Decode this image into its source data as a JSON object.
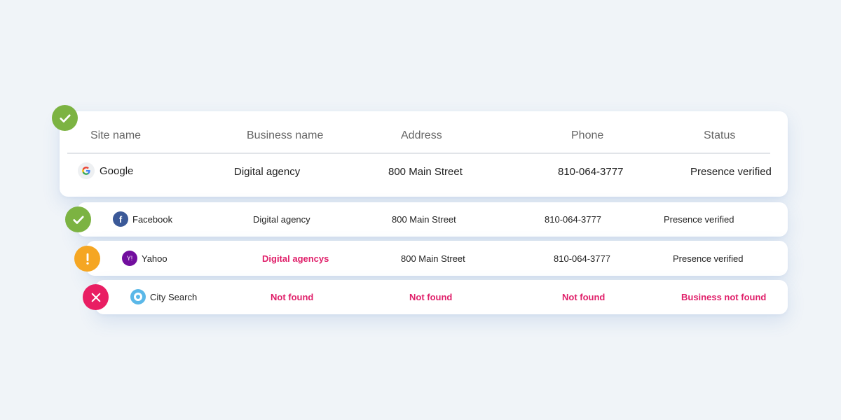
{
  "header": {
    "site_name": "Site name",
    "business_name": "Business name",
    "address": "Address",
    "phone": "Phone",
    "status": "Status"
  },
  "rows": [
    {
      "status_icon": "check-icon",
      "status_color": "#7cb342",
      "site_logo": "google-logo-icon",
      "site": "Google",
      "business": "Digital agency",
      "address": "800 Main Street",
      "phone": "810-064-3777",
      "status": "Presence verified"
    },
    {
      "status_icon": "check-icon",
      "status_color": "#7cb342",
      "site_logo": "facebook-logo-icon",
      "site": "Facebook",
      "business": "Digital agency",
      "address": "800 Main Street",
      "phone": "810-064-3777",
      "status": "Presence verified"
    },
    {
      "status_icon": "exclamation-icon",
      "status_color": "#f5a623",
      "site_logo": "yahoo-logo-icon",
      "site": "Yahoo",
      "logo_text": "Y!",
      "business": "Digital agencys",
      "address": "800 Main Street",
      "phone": "810-064-3777",
      "status": "Presence verified"
    },
    {
      "status_icon": "close-icon",
      "status_color": "#e91e63",
      "site_logo": "citysearch-logo-icon",
      "site": "City Search",
      "business": "Not found",
      "address": "Not found",
      "phone": "Not found",
      "status": "Business not found"
    }
  ],
  "colors": {
    "success": "#7cb342",
    "warning": "#f5a623",
    "error": "#e91e63",
    "error_text": "#e0206a",
    "facebook": "#3b5998",
    "yahoo": "#720e9e",
    "citysearch": "#5bb8e8"
  }
}
